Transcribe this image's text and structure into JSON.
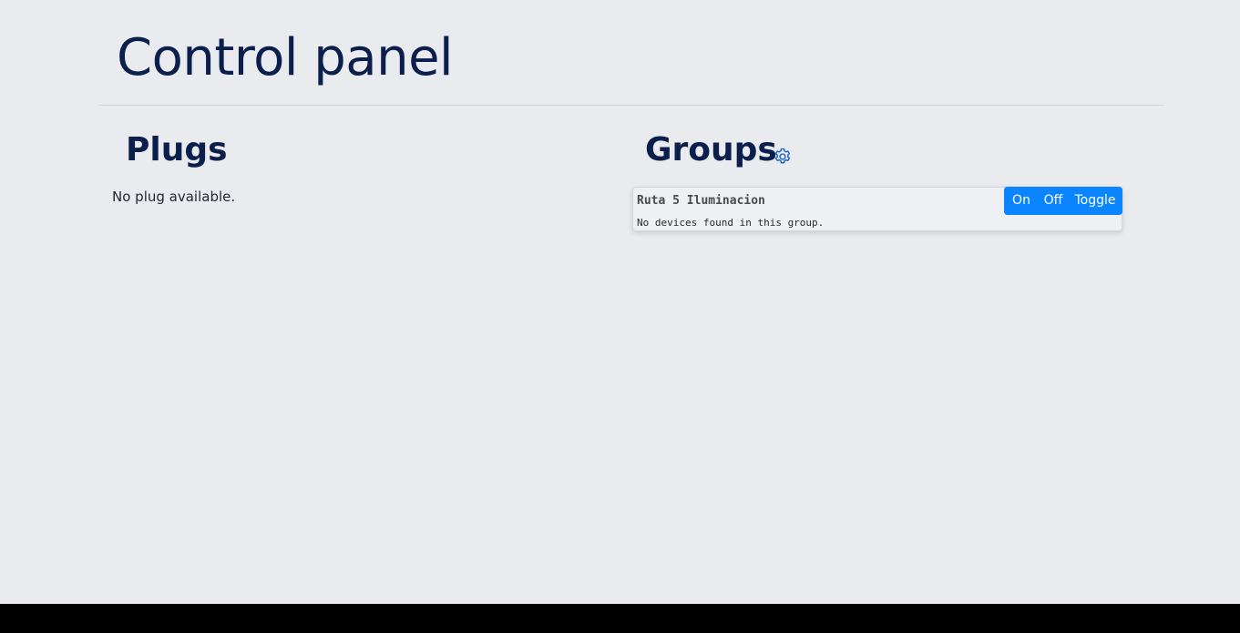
{
  "header": {
    "title": "Control panel"
  },
  "plugs": {
    "heading": "Plugs",
    "empty_message": "No plug available."
  },
  "groups": {
    "heading": "Groups",
    "settings_icon": "gear-icon",
    "items": [
      {
        "name": "Ruta 5 Iluminacion",
        "empty_message": "No devices found in this group.",
        "actions": {
          "on_label": "On",
          "off_label": "Off",
          "toggle_label": "Toggle"
        }
      }
    ]
  },
  "colors": {
    "background": "#eaebef",
    "heading": "#0b1f4d",
    "accent": "#0b84ff",
    "icon": "#1f66c7"
  }
}
